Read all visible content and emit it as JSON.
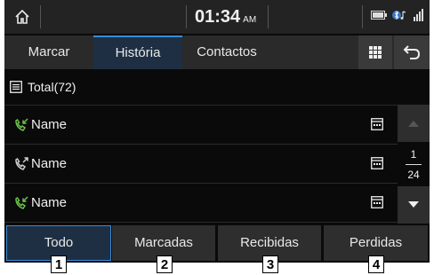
{
  "status": {
    "time": "01:34",
    "ampm": "AM"
  },
  "tabs": {
    "marcar": "Marcar",
    "historia": "História",
    "contactos": "Contactos"
  },
  "total_label": "Total(72)",
  "calls": [
    {
      "name": "Name",
      "type": "incoming",
      "color": "#6cc24a"
    },
    {
      "name": "Name",
      "type": "outgoing",
      "color": "#cfcfcf"
    },
    {
      "name": "Name",
      "type": "incoming",
      "color": "#6cc24a"
    }
  ],
  "pager": {
    "current": "1",
    "total": "24"
  },
  "filters": {
    "todo": "Todo",
    "marcadas": "Marcadas",
    "recibidas": "Recibidas",
    "perdidas": "Perdidas"
  },
  "callouts": [
    "1",
    "2",
    "3",
    "4"
  ],
  "colors": {
    "accent": "#3a8cd8",
    "active_bg": "#1e2f44",
    "incoming_green": "#6cc24a"
  }
}
